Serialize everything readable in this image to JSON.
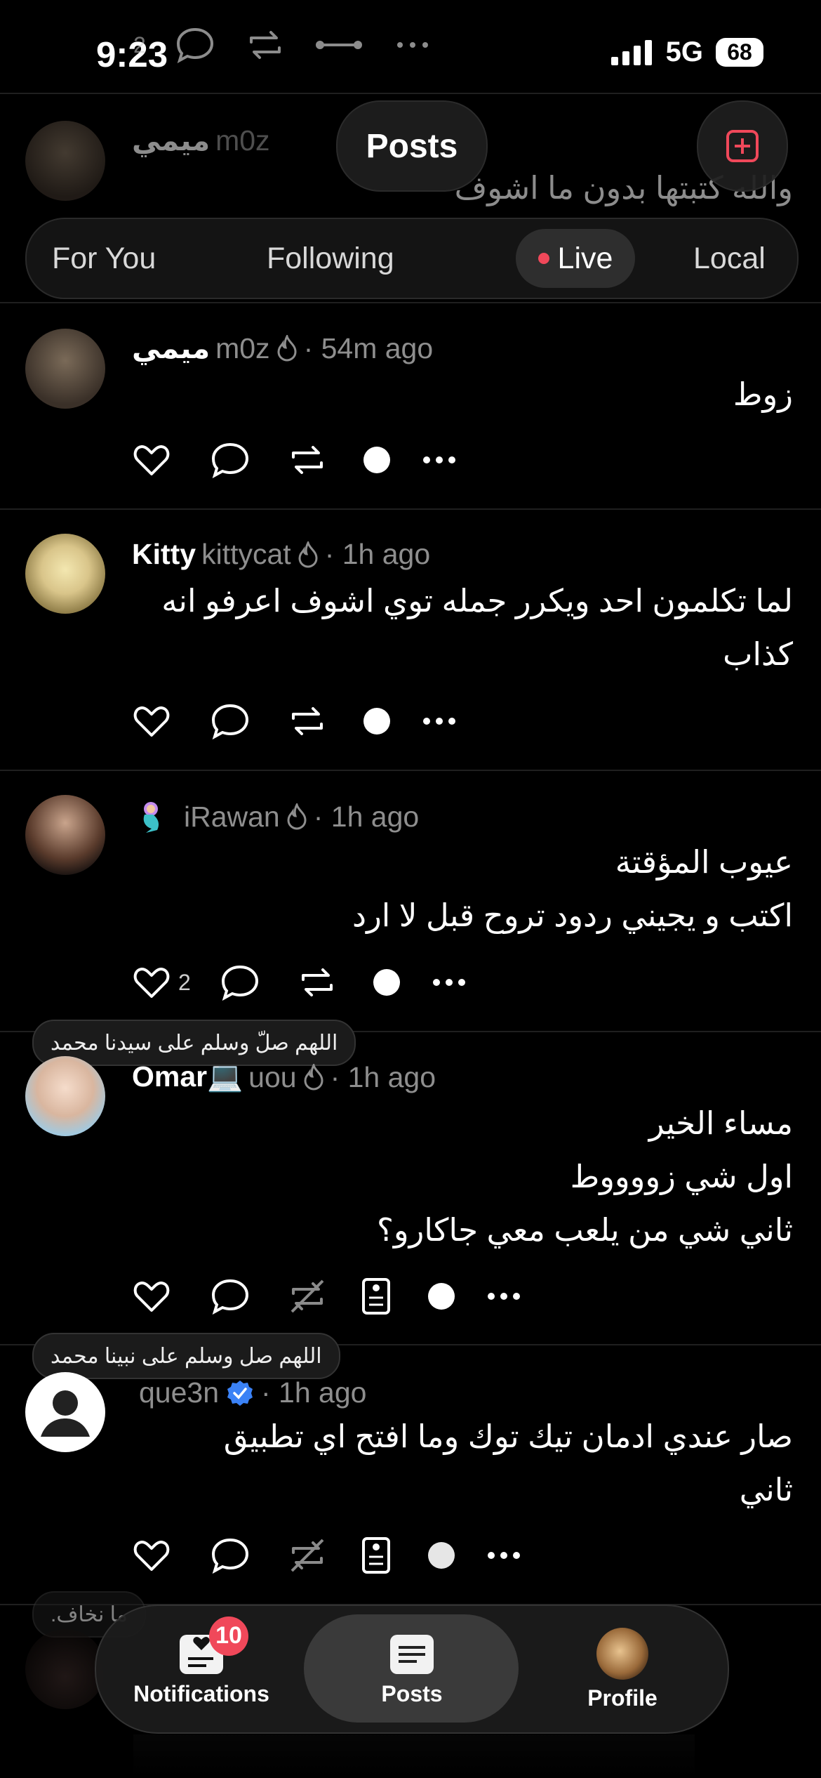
{
  "status_bar": {
    "time": "9:23",
    "network": "5G",
    "battery": "68"
  },
  "header": {
    "title": "Posts"
  },
  "tabs": [
    {
      "label": "For You"
    },
    {
      "label": "Following"
    },
    {
      "label": "Live",
      "selected": true
    },
    {
      "label": "Local"
    }
  ],
  "faded_post": {
    "name": "ميمي",
    "handle": "m0z",
    "text": "والله كتبتها بدون ما اشوف",
    "like_count": "2"
  },
  "posts": [
    {
      "name": "ميمي",
      "handle": "m0z",
      "time": "· 54m ago",
      "lines": [
        "زوط"
      ]
    },
    {
      "name": "Kitty",
      "handle": "kittycat",
      "time": "· 1h ago",
      "lines": [
        "لما تكلمون احد ويكرر جمله توي اشوف اعرفو انه",
        "كذاب"
      ]
    },
    {
      "name": "",
      "handle": "iRawan",
      "time": "· 1h ago",
      "lines": [
        "عيوب المؤقتة",
        "اكتب و يجيني ردود تروح قبل لا ارد"
      ],
      "like_count": "2"
    },
    {
      "name": "Omar💻",
      "handle": "uou",
      "time": "· 1h ago",
      "badge": "اللهم صلّ وسلم على سيدنا محمد",
      "lines": [
        "مساء الخير",
        "اول شي زووووط",
        "ثاني شي من يلعب معي جاكارو؟"
      ]
    },
    {
      "name": "",
      "handle": "que3n",
      "time": "· 1h ago",
      "badge": "اللهم صل وسلم على نبينا محمد",
      "lines": [
        "صار عندي ادمان تيك توك وما افتح اي تطبيق",
        "ثاني"
      ]
    }
  ],
  "partial_post": {
    "badge": "ما نخاف."
  },
  "bottom_nav": {
    "items": [
      {
        "label": "Notifications",
        "badge": "10"
      },
      {
        "label": "Posts",
        "selected": true
      },
      {
        "label": "Profile"
      }
    ]
  },
  "colors": {
    "background": "#000000",
    "accent_red": "#f0485a",
    "verified_blue": "#3b82f6",
    "muted_text": "#8e8e8e"
  }
}
